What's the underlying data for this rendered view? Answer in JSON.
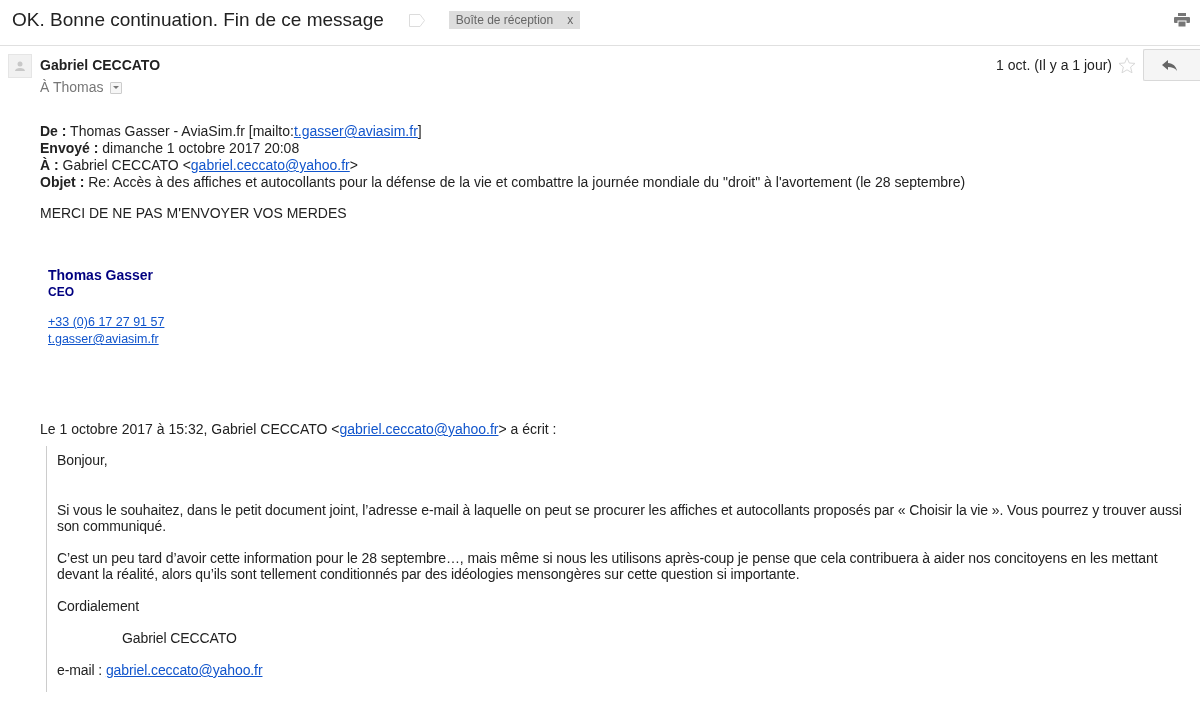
{
  "subject": "OK. Bonne continuation. Fin de ce message",
  "labels": [
    {
      "text": "Boîte de réception",
      "remove": "x"
    }
  ],
  "message": {
    "sender": "Gabriel CECCATO",
    "recipient": "À Thomas",
    "date": "1 oct. (Il y a 1 jour)",
    "starred": false
  },
  "header_fields": [
    {
      "label": "De :",
      "parts": [
        {
          "kind": "text",
          "text": "Thomas Gasser - AviaSim.fr [mailto:"
        },
        {
          "kind": "link",
          "text": "t.gasser@aviasim.fr"
        },
        {
          "kind": "text",
          "text": "]"
        }
      ]
    },
    {
      "label": "Envoyé :",
      "parts": [
        {
          "kind": "text",
          "text": "dimanche 1 octobre 2017 20:08"
        }
      ]
    },
    {
      "label": "À :",
      "parts": [
        {
          "kind": "text",
          "text": "Gabriel CECCATO <"
        },
        {
          "kind": "link",
          "text": "gabriel.ceccato@yahoo.fr"
        },
        {
          "kind": "text",
          "text": ">"
        }
      ]
    },
    {
      "label": "Objet :",
      "parts": [
        {
          "kind": "text",
          "text": "Re: Accès à des affiches et autocollants pour la défense de la vie et combattre la journée mondiale du \"droit\" à l'avortement (le 28 septembre)"
        }
      ]
    }
  ],
  "body": "MERCI DE NE PAS M'ENVOYER VOS MERDES",
  "signature": {
    "name": "Thomas Gasser",
    "title": "CEO",
    "phone": "+33 (0)6 17 27 91 57",
    "email": "t.gasser@aviasim.fr"
  },
  "quote_attribution": [
    {
      "kind": "text",
      "text": "Le 1 octobre 2017 à 15:32, Gabriel CECCATO <"
    },
    {
      "kind": "link",
      "text": "gabriel.ceccato@yahoo.fr"
    },
    {
      "kind": "text",
      "text": "> a écrit :"
    }
  ],
  "quoted": [
    {
      "indented": false,
      "parts": [
        {
          "kind": "text",
          "text": "Bonjour,"
        }
      ]
    },
    {
      "indented": false,
      "parts": [
        {
          "kind": "text",
          "text": "Si vous le souhaitez, dans le petit document joint, l’adresse e-mail à laquelle on peut se procurer les affiches et autocollants proposés par « Choisir la vie ». Vous pourrez y trouver aussi son communiqué."
        }
      ]
    },
    {
      "indented": false,
      "parts": [
        {
          "kind": "text",
          "text": "C’est un peu tard d’avoir cette information pour le 28 septembre…, mais même si nous les utilisons après-coup je pense que cela contribuera à aider nos concitoyens en les mettant devant la réalité, alors qu’ils sont tellement conditionnés par des idéologies mensongères sur cette question si importante."
        }
      ]
    },
    {
      "indented": false,
      "parts": [
        {
          "kind": "text",
          "text": "Cordialement"
        }
      ]
    },
    {
      "indented": true,
      "parts": [
        {
          "kind": "text",
          "text": "Gabriel CECCATO"
        }
      ]
    },
    {
      "indented": false,
      "parts": [
        {
          "kind": "text",
          "text": "e-mail : "
        },
        {
          "kind": "link",
          "text": "gabriel.ceccato@yahoo.fr"
        }
      ]
    }
  ]
}
